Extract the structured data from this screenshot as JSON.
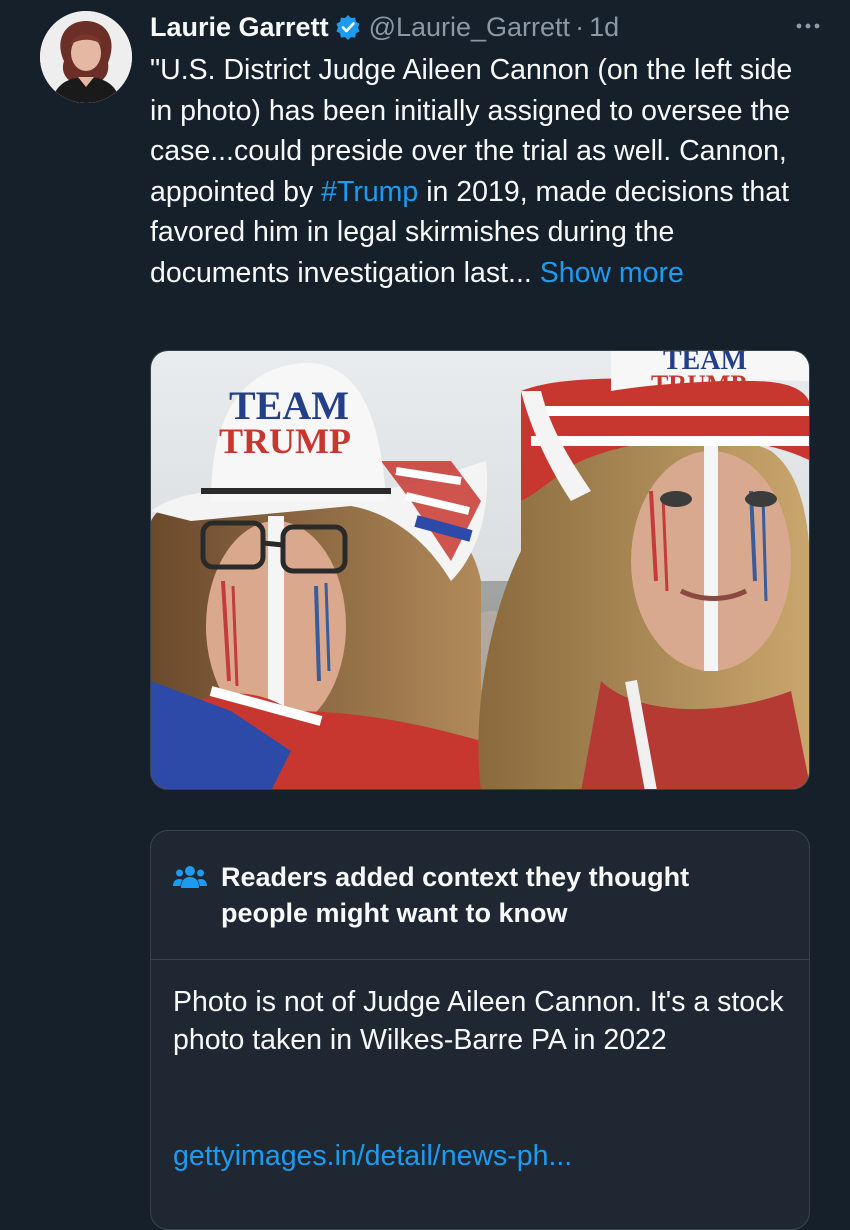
{
  "author": {
    "name": "Laurie Garrett",
    "handle": "@Laurie_Garrett",
    "separator": "·",
    "time": "1d"
  },
  "tweet": {
    "text_1": "\"U.S. District Judge Aileen Cannon (on the left side in photo) has been initially assigned to oversee the case...could preside over the trial as well. Cannon, appointed by ",
    "hashtag": "#Trump",
    "text_2": " in 2019, made decisions that favored him in legal skirmishes during the documents investigation last... ",
    "show_more": "Show more"
  },
  "media": {
    "hat_left_line1": "TEAM",
    "hat_left_line2": "TRUMP",
    "hat_right_line1": "TEAM",
    "hat_right_line2": "TRUMP"
  },
  "community_note": {
    "title": "Readers added context they thought people might want to know",
    "body": "Photo is not of Judge Aileen Cannon. It's a stock photo taken in Wilkes-Barre PA in 2022",
    "link": "gettyimages.in/detail/news-ph..."
  },
  "icons": {
    "verified": "verified-badge-icon",
    "more": "more-options-icon",
    "note": "people-icon"
  },
  "colors": {
    "background": "#15202b",
    "accent": "#1d9bf0",
    "secondary_text": "#8b98a5",
    "note_background": "#1e2732",
    "border": "#38444d"
  }
}
